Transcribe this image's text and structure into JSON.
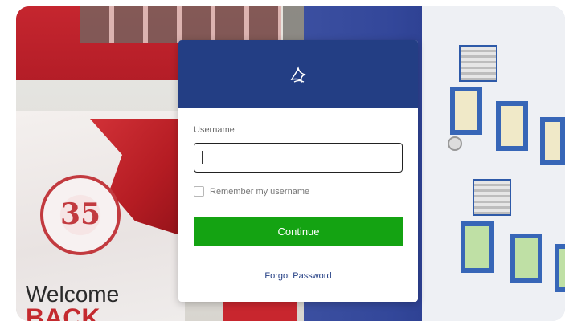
{
  "login": {
    "logo_icon": "school-crest-icon",
    "username_label": "Username",
    "username_value": "",
    "remember_label": "Remember my username",
    "remember_checked": false,
    "continue_label": "Continue",
    "forgot_label": "Forgot Password"
  },
  "background": {
    "seal_number": "35",
    "welcome_text": "Welcome",
    "back_text": "BACK"
  },
  "colors": {
    "header": "#233e84",
    "button": "#14a312",
    "link": "#233e84"
  }
}
